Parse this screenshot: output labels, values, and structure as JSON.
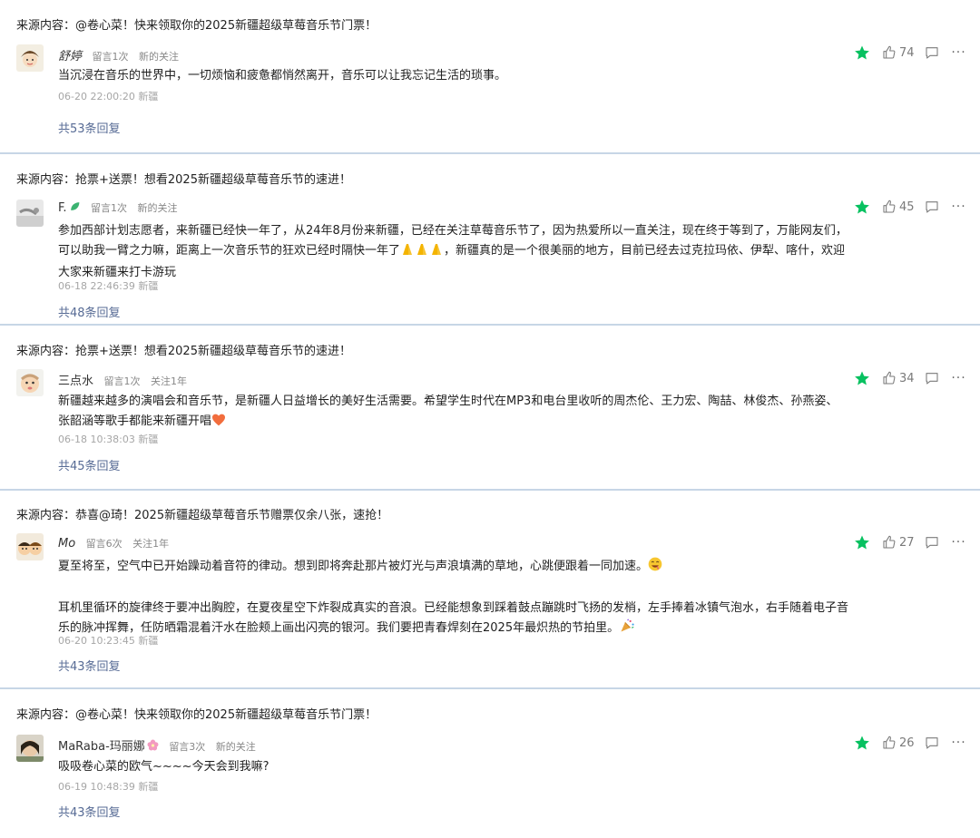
{
  "colors": {
    "star": "#07c160",
    "link": "#576b95",
    "divider": "#c7d6e6",
    "muted": "#a6a6a6"
  },
  "comments": [
    {
      "source": "来源内容：@卷心菜！快来领取你的2025新疆超级草莓音乐节门票！",
      "name": "舒婷",
      "tag1": "留言1次",
      "tag2": "新的关注",
      "content": [
        "当沉浸在音乐的世界中，一切烦恼和疲惫都悄然离开，音乐可以让我忘记生活的琐事。"
      ],
      "time": "06-20 22:00:20 新疆",
      "replies": "共53条回复",
      "likes": "74"
    },
    {
      "source": "来源内容：抢票+送票！想看2025新疆超级草莓音乐节的速进！",
      "name": "F.",
      "tag1": "留言1次",
      "tag2": "新的关注",
      "content": [
        "参加西部计划志愿者，来新疆已经快一年了，从24年8月份来新疆，已经在关注草莓音乐节了，因为热爱所以一直关注，现在终于等到了，万能网友们，可以助我一臂之力嘛，距离上一次音乐节的狂欢已经时隔快一年了",
        "，新疆真的是一个很美丽的地方，目前已经去过克拉玛依、伊犁、喀什，欢迎大家来新疆来打卡游玩"
      ],
      "time": "06-18 22:46:39 新疆",
      "replies": "共48条回复",
      "likes": "45"
    },
    {
      "source": "来源内容：抢票+送票！想看2025新疆超级草莓音乐节的速进！",
      "name": "三点水",
      "tag1": "留言1次",
      "tag2": "关注1年",
      "content": [
        "新疆越来越多的演唱会和音乐节，是新疆人日益增长的美好生活需要。希望学生时代在MP3和电台里收听的周杰伦、王力宏、陶喆、林俊杰、孙燕姿、张韶涵等歌手都能来新疆开唱"
      ],
      "time": "06-18 10:38:03 新疆",
      "replies": "共45条回复",
      "likes": "34"
    },
    {
      "source": "来源内容：恭喜@琦！2025新疆超级草莓音乐节赠票仅余八张，速抢！",
      "name": "Mo",
      "tag1": "留言6次",
      "tag2": "关注1年",
      "content": [
        "夏至将至，空气中已开始躁动着音符的律动。想到即将奔赴那片被灯光与声浪填满的草地，心跳便跟着一同加速。",
        "耳机里循环的旋律终于要冲出胸腔，在夏夜星空下炸裂成真实的音浪。已经能想象到踩着鼓点蹦跳时飞扬的发梢，左手捧着冰镇气泡水，右手随着电子音乐的脉冲挥舞，任防晒霜混着汗水在脸颊上画出闪亮的银河。我们要把青春焊刻在2025年最炽热的节拍里。"
      ],
      "time": "06-20 10:23:45 新疆",
      "replies": "共43条回复",
      "likes": "27"
    },
    {
      "source": "来源内容：@卷心菜！快来领取你的2025新疆超级草莓音乐节门票！",
      "name": "MaRaba-玛丽娜",
      "tag1": "留言3次",
      "tag2": "新的关注",
      "content": [
        "吸吸卷心菜的欧气~~~~今天会到我嘛?"
      ],
      "time": "06-19 10:48:39 新疆",
      "replies": "共43条回复",
      "likes": "26"
    }
  ]
}
